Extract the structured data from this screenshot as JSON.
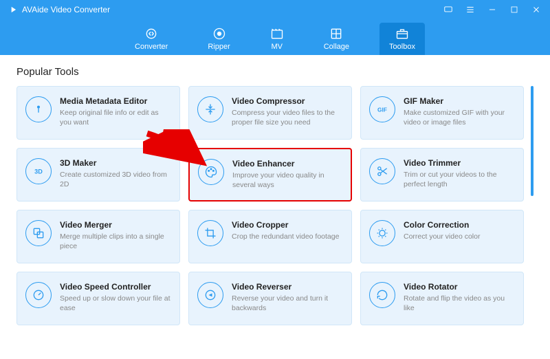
{
  "app": {
    "title": "AVAide Video Converter"
  },
  "nav": {
    "items": [
      {
        "label": "Converter"
      },
      {
        "label": "Ripper"
      },
      {
        "label": "MV"
      },
      {
        "label": "Collage"
      },
      {
        "label": "Toolbox"
      }
    ],
    "active_index": 4
  },
  "section": {
    "title": "Popular Tools"
  },
  "cards": [
    {
      "title": "Media Metadata Editor",
      "desc": "Keep original file info or edit as you want",
      "icon": "info"
    },
    {
      "title": "Video Compressor",
      "desc": "Compress your video files to the proper file size you need",
      "icon": "compress"
    },
    {
      "title": "GIF Maker",
      "desc": "Make customized GIF with your video or image files",
      "icon": "gif"
    },
    {
      "title": "3D Maker",
      "desc": "Create customized 3D video from 2D",
      "icon": "3d"
    },
    {
      "title": "Video Enhancer",
      "desc": "Improve your video quality in several ways",
      "icon": "palette",
      "highlight": true
    },
    {
      "title": "Video Trimmer",
      "desc": "Trim or cut your videos to the perfect length",
      "icon": "scissors"
    },
    {
      "title": "Video Merger",
      "desc": "Merge multiple clips into a single piece",
      "icon": "merge"
    },
    {
      "title": "Video Cropper",
      "desc": "Crop the redundant video footage",
      "icon": "crop"
    },
    {
      "title": "Color Correction",
      "desc": "Correct your video color",
      "icon": "color"
    },
    {
      "title": "Video Speed Controller",
      "desc": "Speed up or slow down your file at ease",
      "icon": "speed"
    },
    {
      "title": "Video Reverser",
      "desc": "Reverse your video and turn it backwards",
      "icon": "reverse"
    },
    {
      "title": "Video Rotator",
      "desc": "Rotate and flip the video as you like",
      "icon": "rotate"
    }
  ],
  "colors": {
    "accent": "#2d9cf0",
    "card_bg": "#e8f3fd",
    "highlight": "#e60000"
  }
}
